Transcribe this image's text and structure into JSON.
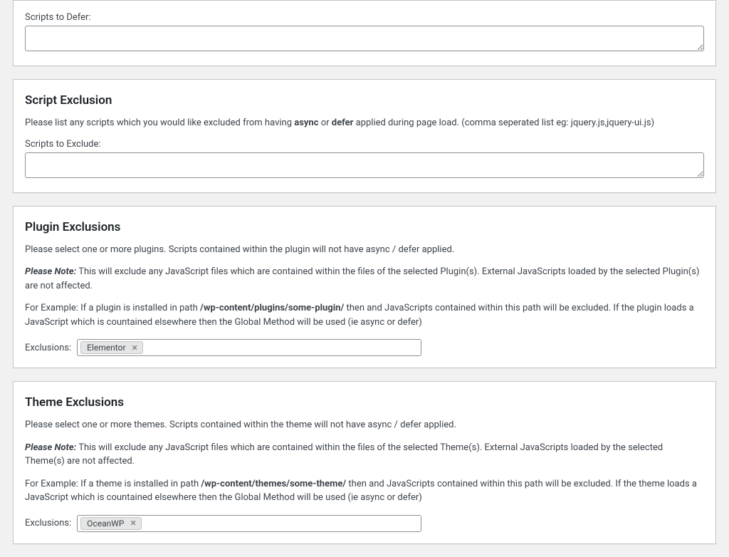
{
  "defer": {
    "label": "Scripts to Defer:",
    "value": ""
  },
  "script_exclusion": {
    "heading": "Script Exclusion",
    "desc_before": "Please list any scripts which you would like excluded from having ",
    "bold1": "async",
    "desc_mid": " or ",
    "bold2": "defer",
    "desc_after": " applied during page load. (comma seperated list eg: jquery.js,jquery-ui.js)",
    "label": "Scripts to Exclude:",
    "value": ""
  },
  "plugin_exclusions": {
    "heading": "Plugin Exclusions",
    "p1": "Please select one or more plugins. Scripts contained within the plugin will not have async / defer applied.",
    "note_label": "Please Note:",
    "note_text": " This will exclude any JavaScript files which are contained within the files of the selected Plugin(s). External JavaScripts loaded by the selected Plugin(s) are not affected.",
    "ex_before": "For Example: If a plugin is installed in path ",
    "ex_bold": "/wp-content/plugins/some-plugin/",
    "ex_after": " then and JavaScripts contained within this path will be excluded. If the plugin loads a JavaScript which is countained elsewhere then the Global Method will be used (ie async or defer)",
    "field_label": "Exclusions:",
    "tag": "Elementor"
  },
  "theme_exclusions": {
    "heading": "Theme Exclusions",
    "p1": "Please select one or more themes. Scripts contained within the theme will not have async / defer applied.",
    "note_label": "Please Note:",
    "note_text": " This will exclude any JavaScript files which are contained within the files of the selected Theme(s). External JavaScripts loaded by the selected Theme(s) are not affected.",
    "ex_before": "For Example: If a theme is installed in path ",
    "ex_bold": "/wp-content/themes/some-theme/",
    "ex_after": " then and JavaScripts contained within this path will be excluded. If the theme loads a JavaScript which is countained elsewhere then the Global Method will be used (ie async or defer)",
    "field_label": "Exclusions:",
    "tag": "OceanWP"
  }
}
